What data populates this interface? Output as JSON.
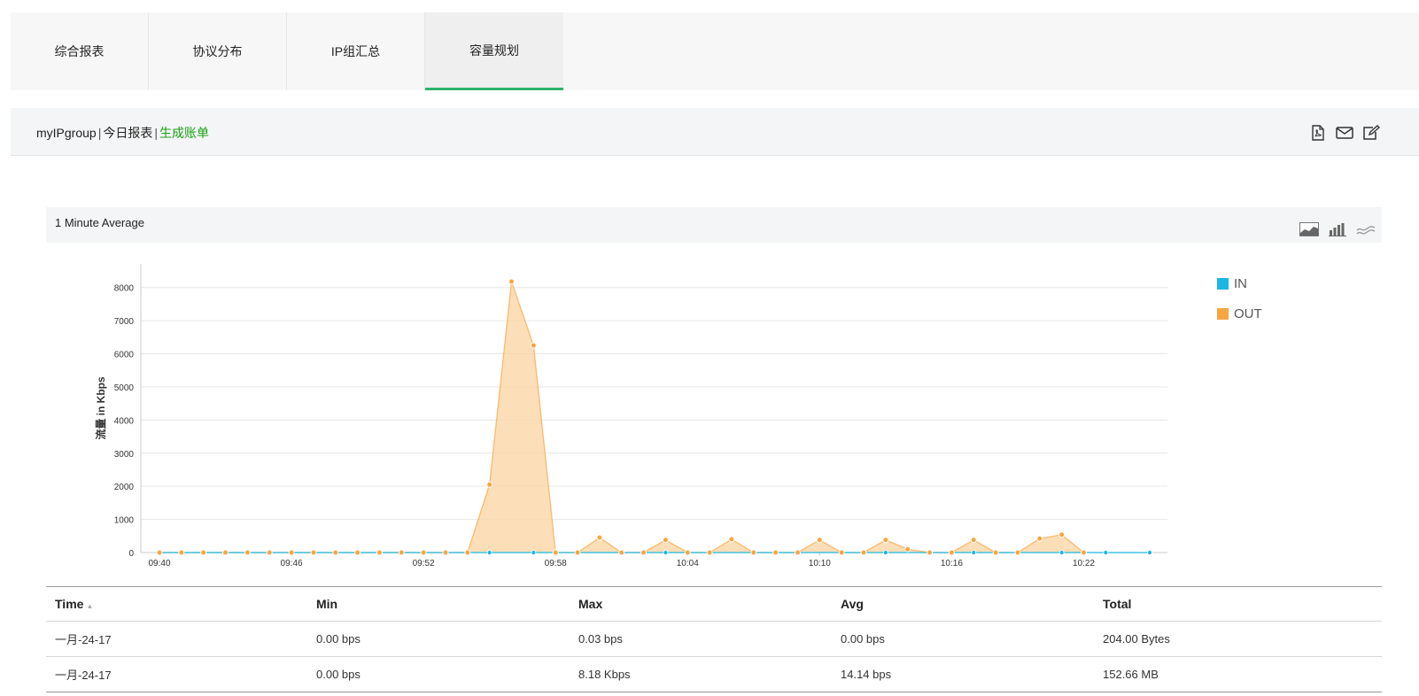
{
  "tabs": [
    {
      "label": "综合报表",
      "active": false
    },
    {
      "label": "协议分布",
      "active": false
    },
    {
      "label": "IP组汇总",
      "active": false
    },
    {
      "label": "容量规划",
      "active": true
    }
  ],
  "header": {
    "group": "myIPgroup",
    "separator": "|",
    "report": "今日报表",
    "billing_link": "生成账单",
    "icons": [
      "pdf-icon",
      "email-icon",
      "edit-icon"
    ]
  },
  "panel": {
    "title": "1 Minute Average",
    "chart_type_icons": [
      "area-chart-icon",
      "bar-chart-icon",
      "line-chart-icon"
    ]
  },
  "colors": {
    "accent": "#2fb36b",
    "link": "#17a317",
    "in_series": "#1ab8e0",
    "out_series": "#f7a540",
    "out_fill": "#fbd6a8"
  },
  "chart_data": {
    "type": "area",
    "ylabel": "流量 in Kbps",
    "ylim": [
      0,
      8500
    ],
    "yticks": [
      0,
      1000,
      2000,
      3000,
      4000,
      5000,
      6000,
      7000,
      8000
    ],
    "xtick_labels": [
      "09:40",
      "09:46",
      "09:52",
      "09:58",
      "10:04",
      "10:10",
      "10:16",
      "10:22"
    ],
    "x_start_label": "09:40",
    "x_minutes": [
      0,
      1,
      2,
      3,
      4,
      5,
      6,
      7,
      8,
      9,
      10,
      11,
      12,
      13,
      14,
      15,
      16,
      17,
      18,
      19,
      20,
      21,
      22,
      23,
      24,
      25,
      26,
      27,
      28,
      29,
      30,
      31,
      32,
      33,
      34,
      35,
      36,
      37,
      38,
      39,
      40,
      41,
      42,
      43,
      44,
      45
    ],
    "series": [
      {
        "name": "IN",
        "color": "#1ab8e0",
        "values": [
          0,
          0,
          0,
          0,
          0,
          0,
          0,
          0,
          0,
          0,
          0,
          0,
          0,
          0,
          0,
          0,
          0,
          0,
          0,
          0,
          0,
          0,
          0,
          0,
          0,
          0,
          0,
          0,
          0,
          0,
          0,
          0,
          0,
          0,
          0,
          0,
          0,
          0,
          0,
          0,
          0,
          0,
          0,
          0,
          0,
          0
        ]
      },
      {
        "name": "OUT",
        "color": "#f7a540",
        "values": [
          0,
          0,
          0,
          0,
          0,
          0,
          0,
          0,
          0,
          0,
          0,
          0,
          0,
          0,
          0,
          2050,
          8180,
          6250,
          0,
          0,
          450,
          0,
          0,
          380,
          0,
          0,
          400,
          0,
          0,
          0,
          380,
          0,
          0,
          380,
          100,
          0,
          0,
          380,
          0,
          0,
          420,
          540,
          0
        ]
      }
    ],
    "grid": true,
    "legend": "right"
  },
  "legend": [
    {
      "name": "IN",
      "color": "#1ab8e0"
    },
    {
      "name": "OUT",
      "color": "#f7a540"
    }
  ],
  "table": {
    "columns": [
      "Time",
      "Min",
      "Max",
      "Avg",
      "Total"
    ],
    "rows": [
      [
        "一月-24-17",
        "0.00 bps",
        "0.03 bps",
        "0.00 bps",
        "204.00 Bytes"
      ],
      [
        "一月-24-17",
        "0.00 bps",
        "8.18 Kbps",
        "14.14 bps",
        "152.66 MB"
      ]
    ]
  }
}
